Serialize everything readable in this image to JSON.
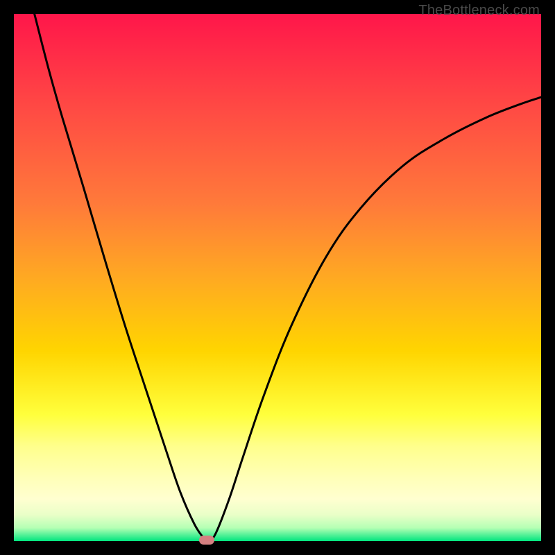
{
  "watermark": "TheBottleneck.com",
  "colors": {
    "top": "#ff164a",
    "mid1": "#ff7a3a",
    "mid2": "#ffd500",
    "pale": "#ffffb0",
    "green": "#00e57e",
    "curve": "#000000",
    "marker": "#d58081"
  },
  "chart_data": {
    "type": "line",
    "title": "",
    "xlabel": "",
    "ylabel": "",
    "xlim": [
      0,
      100
    ],
    "ylim": [
      0,
      100
    ],
    "legend": false,
    "annotation": "TheBottleneck.com",
    "gradient_axis": "y",
    "gradient_colors": [
      {
        "stop": 0.0,
        "hex": "#ff164a"
      },
      {
        "stop": 0.36,
        "hex": "#ff7a3a"
      },
      {
        "stop": 0.64,
        "hex": "#ffd500"
      },
      {
        "stop": 0.82,
        "hex": "#ffff8c"
      },
      {
        "stop": 0.9,
        "hex": "#ffffc8"
      },
      {
        "stop": 0.97,
        "hex": "#c8ffb4"
      },
      {
        "stop": 1.0,
        "hex": "#00e57e"
      }
    ],
    "series": [
      {
        "name": "curve",
        "x": [
          3.9,
          6.6,
          9.2,
          13.2,
          17.1,
          21.1,
          25.0,
          28.9,
          31.6,
          34.2,
          35.9,
          36.8,
          38.2,
          40.8,
          43.4,
          47.4,
          52.6,
          59.2,
          65.8,
          73.7,
          81.6,
          89.5,
          96.1,
          100.0
        ],
        "y": [
          100.0,
          89.5,
          80.3,
          67.1,
          53.9,
          40.8,
          28.9,
          17.1,
          9.2,
          3.3,
          0.7,
          0.0,
          1.3,
          7.9,
          15.8,
          27.6,
          40.8,
          53.9,
          63.2,
          71.1,
          76.3,
          80.3,
          82.9,
          84.2
        ]
      }
    ],
    "marker": {
      "x": 36.6,
      "y": 0.0
    }
  }
}
